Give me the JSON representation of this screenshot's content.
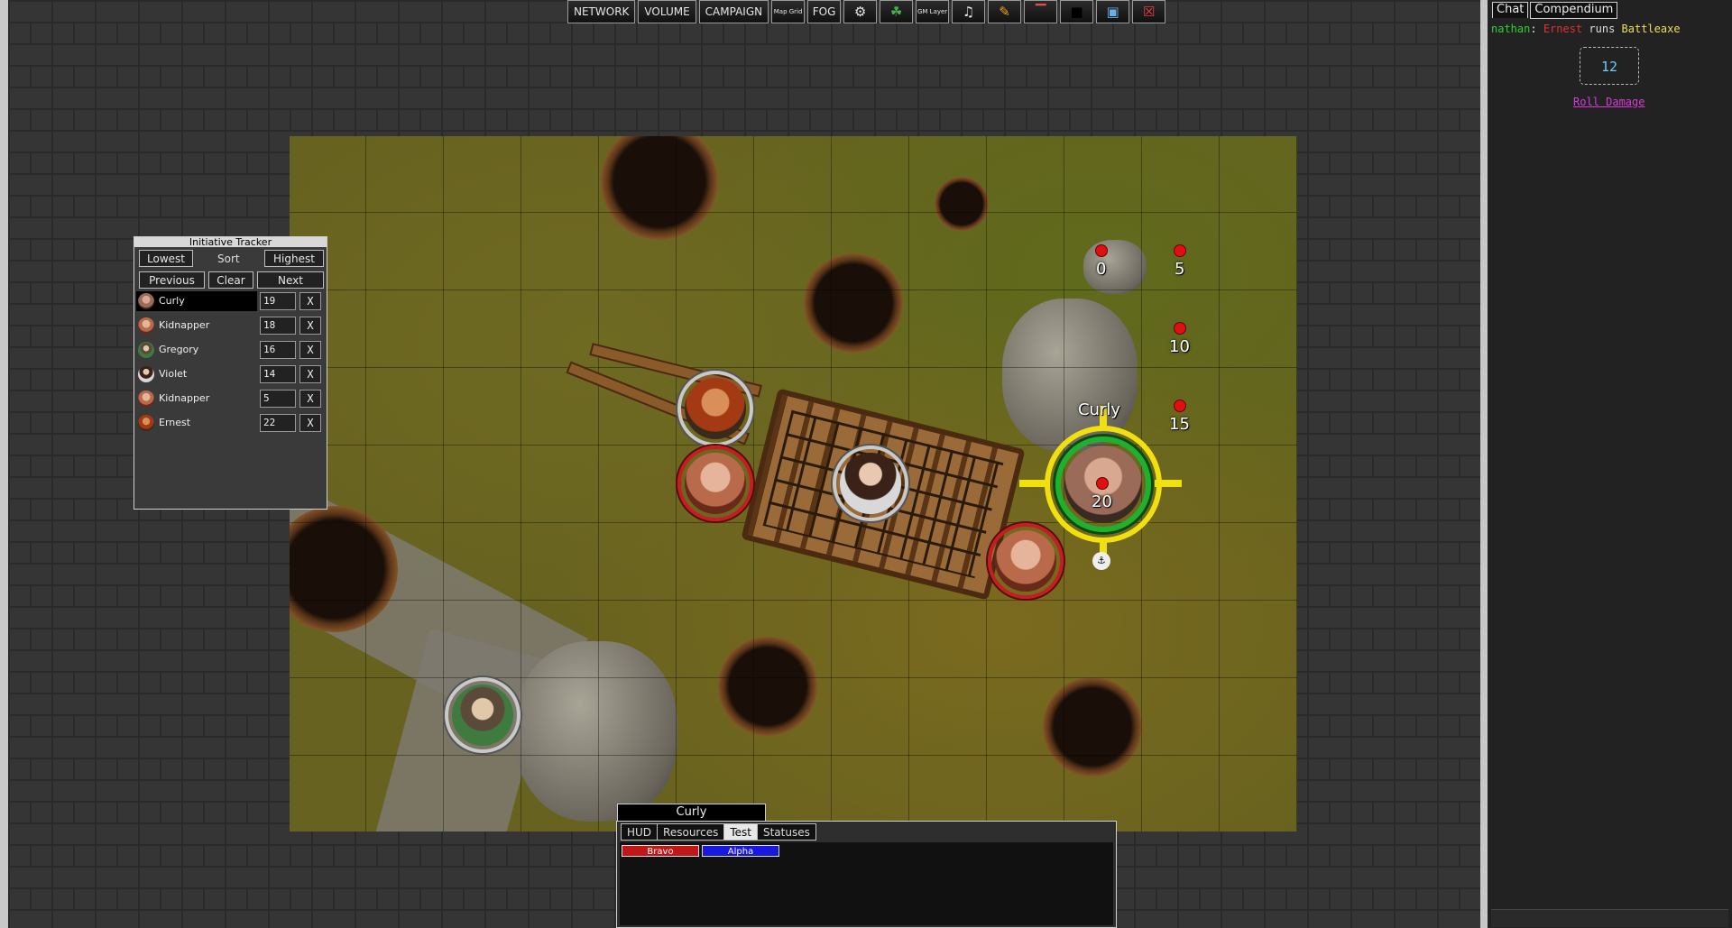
{
  "toolbar": {
    "network": "NETWORK",
    "volume": "VOLUME",
    "campaign": "CAMPAIGN",
    "map_grid": "Map Grid",
    "fog": "FOG",
    "gm_layer": "GM Layer",
    "icons": [
      "map-grid-icon",
      "fog-icon",
      "dice-icon",
      "tree-icon",
      "gm-layer-icon",
      "music-icon",
      "pencil-icon",
      "ruler-icon",
      "black-square-icon",
      "image-icon",
      "clear-icon"
    ]
  },
  "initiative": {
    "title": "Initiative Tracker",
    "lowest": "Lowest",
    "sort": "Sort",
    "highest": "Highest",
    "previous": "Previous",
    "clear": "Clear",
    "next": "Next",
    "remove": "X",
    "rows": [
      {
        "name": "Curly",
        "value": "19"
      },
      {
        "name": "Kidnapper",
        "value": "18"
      },
      {
        "name": "Gregory",
        "value": "16"
      },
      {
        "name": "Violet",
        "value": "14"
      },
      {
        "name": "Kidnapper",
        "value": "5"
      },
      {
        "name": "Ernest",
        "value": "22"
      }
    ]
  },
  "map": {
    "selected_token_name": "Curly",
    "range_labels": [
      "0",
      "5",
      "10",
      "15",
      "20"
    ],
    "colors": {
      "selection_ring": "#f0e010",
      "health_ring": "#20b030",
      "enemy_ring": "#c22020",
      "range_dot": "#e01010"
    }
  },
  "panel": {
    "token_name": "Curly",
    "tabs": [
      "HUD",
      "Resources",
      "Test",
      "Statuses"
    ],
    "selected_tab": "Test",
    "bars": [
      {
        "label": "Bravo",
        "color": "#c01818"
      },
      {
        "label": "Alpha",
        "color": "#1818e0"
      }
    ]
  },
  "chat": {
    "tabs": [
      "Chat",
      "Compendium"
    ],
    "user": "nathan",
    "colon": ": ",
    "character": "Ernest",
    "action": " runs ",
    "item": "Battleaxe",
    "roll_result": "12",
    "roll_damage": "Roll Damage"
  }
}
